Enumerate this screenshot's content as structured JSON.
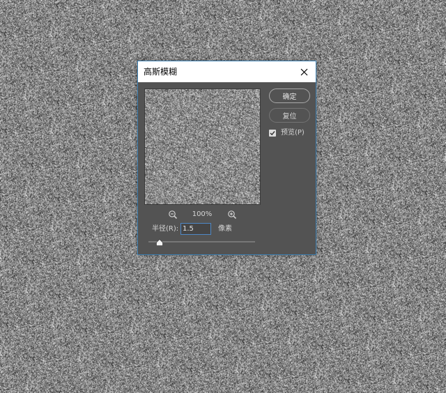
{
  "dialog": {
    "title": "高斯模糊",
    "close_icon": "close-icon",
    "ok_label": "确定",
    "reset_label": "复位",
    "preview_checkbox": {
      "label": "预览(P)",
      "checked": true
    },
    "zoom": {
      "level": "100%",
      "zoom_out_icon": "zoom-out-icon",
      "zoom_in_icon": "zoom-in-icon"
    },
    "radius": {
      "label": "半径(R):",
      "value": "1.5",
      "unit": "像素",
      "slider_fraction": 0.05
    }
  },
  "colors": {
    "dialog_bg": "#535353",
    "title_bg": "#ffffff",
    "input_border": "#4e88c7",
    "text": "#d6d6d6"
  }
}
